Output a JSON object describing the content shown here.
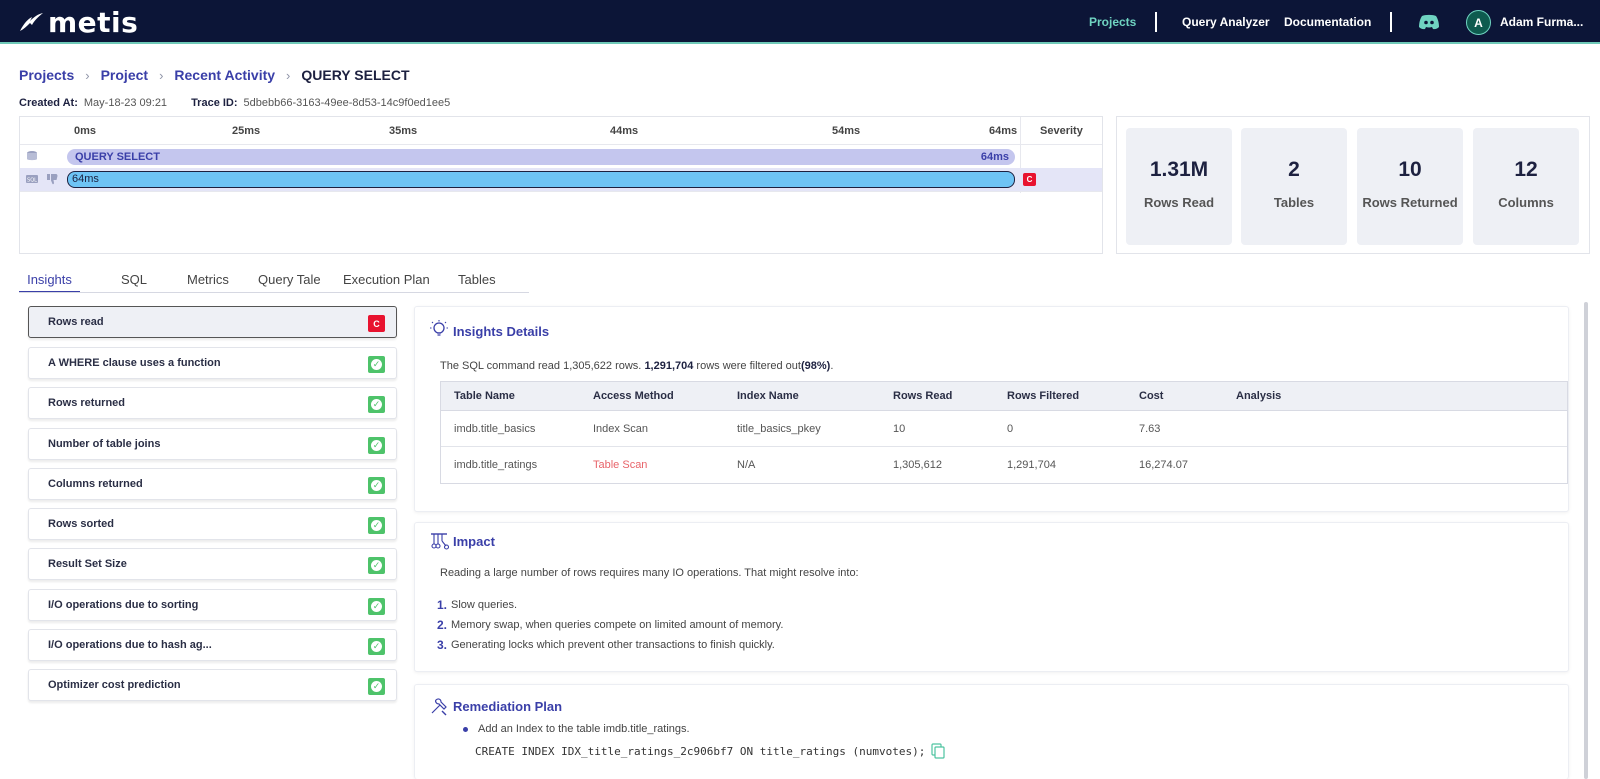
{
  "header": {
    "logo_text": "metis",
    "nav": {
      "projects": "Projects",
      "query_analyzer": "Query Analyzer",
      "documentation": "Documentation"
    },
    "user": {
      "initial": "A",
      "name": "Adam Furma..."
    },
    "colors": {
      "bg": "#0c1537",
      "accent": "#6fd3c1"
    }
  },
  "breadcrumb": [
    "Projects",
    "Project",
    "Recent Activity",
    "QUERY SELECT"
  ],
  "meta": {
    "created_label": "Created At:",
    "created_value": "May-18-23 09:21",
    "trace_label": "Trace ID:",
    "trace_value": "5dbebb66-3163-49ee-8d53-14c9f0ed1ee5"
  },
  "timeline": {
    "ticks": [
      "0ms",
      "25ms",
      "35ms",
      "44ms",
      "54ms",
      "64ms"
    ],
    "severity_label": "Severity",
    "rows": [
      {
        "label": "QUERY SELECT",
        "value": "64ms"
      },
      {
        "label": "64ms",
        "severity": "C"
      }
    ]
  },
  "stats": [
    {
      "value": "1.31M",
      "label": "Rows Read"
    },
    {
      "value": "2",
      "label": "Tables"
    },
    {
      "value": "10",
      "label": "Rows Returned"
    },
    {
      "value": "12",
      "label": "Columns"
    }
  ],
  "tabs": [
    "Insights",
    "SQL",
    "Metrics",
    "Query Tale",
    "Execution Plan",
    "Tables"
  ],
  "insights": [
    {
      "label": "Rows read",
      "status": "C"
    },
    {
      "label": "A WHERE clause uses a function",
      "status": "ok"
    },
    {
      "label": "Rows returned",
      "status": "ok"
    },
    {
      "label": "Number of table joins",
      "status": "ok"
    },
    {
      "label": "Columns returned",
      "status": "ok"
    },
    {
      "label": "Rows sorted",
      "status": "ok"
    },
    {
      "label": "Result Set Size",
      "status": "ok"
    },
    {
      "label": "I/O operations due to sorting",
      "status": "ok"
    },
    {
      "label": "I/O operations due to hash ag...",
      "status": "ok"
    },
    {
      "label": "Optimizer cost prediction",
      "status": "ok"
    }
  ],
  "details": {
    "title": "Insights Details",
    "summary_pre": "The SQL command read 1,305,622 rows. ",
    "summary_bold": "1,291,704",
    "summary_mid": " rows were filtered out",
    "summary_pct": "(98%)",
    "summary_end": ".",
    "columns": [
      "Table Name",
      "Access Method",
      "Index Name",
      "Rows Read",
      "Rows Filtered",
      "Cost",
      "Analysis"
    ],
    "rows": [
      [
        "imdb.title_basics",
        "Index Scan",
        "title_basics_pkey",
        "10",
        "0",
        "7.63",
        ""
      ],
      [
        "imdb.title_ratings",
        "Table Scan",
        "N/A",
        "1,305,612",
        "1,291,704",
        "16,274.07",
        ""
      ]
    ]
  },
  "impact": {
    "title": "Impact",
    "intro": "Reading a large number of rows requires many IO operations. That might resolve into:",
    "items": [
      {
        "num": "1.",
        "text": "Slow queries."
      },
      {
        "num": "2.",
        "text": "Memory swap, when queries compete on limited amount of memory."
      },
      {
        "num": "3.",
        "text": "Generating locks which prevent other transactions to finish quickly."
      }
    ]
  },
  "remediation": {
    "title": "Remediation Plan",
    "bullet": "Add an Index to the table imdb.title_ratings.",
    "code": "CREATE INDEX IDX_title_ratings_2c906bf7  ON title_ratings (numvotes);"
  }
}
